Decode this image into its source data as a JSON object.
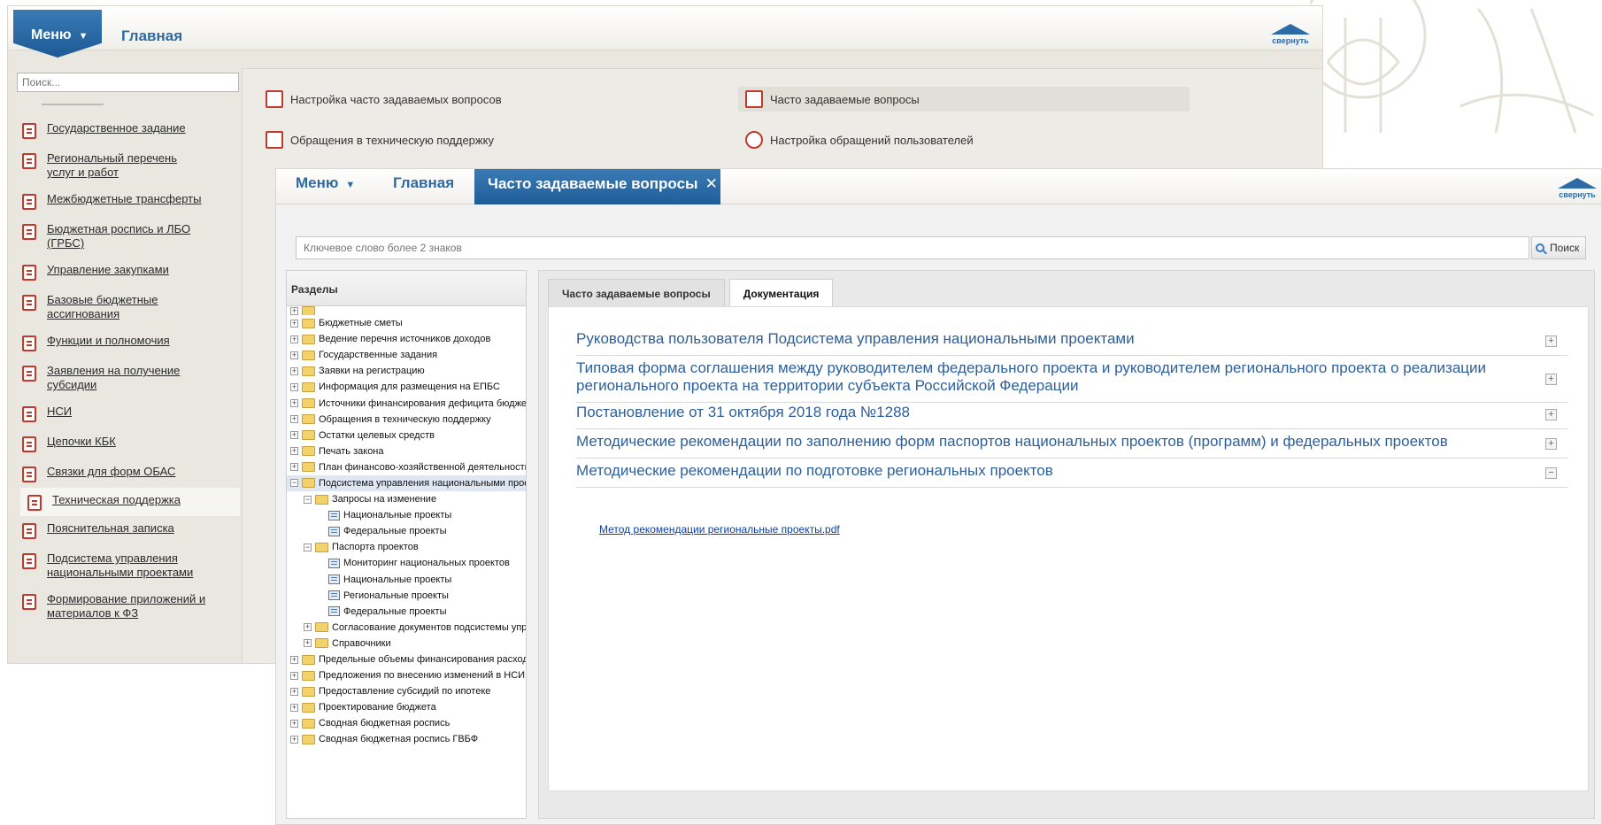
{
  "back_window": {
    "menu_label": "Меню",
    "home_label": "Главная",
    "collapse_label": "свернуть",
    "search_placeholder": "Поиск...",
    "sidebar_items": [
      {
        "label": "Государственное задание"
      },
      {
        "label": "Региональный перечень услуг и работ"
      },
      {
        "label": "Межбюджетные трансферты"
      },
      {
        "label": "Бюджетная роспись и ЛБО (ГРБС)"
      },
      {
        "label": "Управление закупками"
      },
      {
        "label": "Базовые бюджетные ассигнования"
      },
      {
        "label": "Функции и полномочия"
      },
      {
        "label": "Заявления на получение субсидии"
      },
      {
        "label": "НСИ"
      },
      {
        "label": "Цепочки КБК"
      },
      {
        "label": "Связки для форм ОБАС"
      },
      {
        "label": "Техническая поддержка",
        "active": true
      },
      {
        "label": "Пояснительная записка"
      },
      {
        "label": "Подсистема управления национальными проектами"
      },
      {
        "label": "Формирование приложений и материалов к ФЗ"
      }
    ],
    "links": [
      {
        "label": "Настройка часто задаваемых вопросов"
      },
      {
        "label": "Часто задаваемые вопросы"
      },
      {
        "label": "Обращения в техническую поддержку"
      },
      {
        "label": "Настройка обращений пользователей"
      }
    ]
  },
  "front_window": {
    "menu_label": "Меню",
    "home_label": "Главная",
    "active_tab": "Часто задаваемые вопросы",
    "collapse_label": "свернуть",
    "search": {
      "placeholder": "Ключевое слово более 2 знаков",
      "button_label": "Поиск"
    },
    "tree": {
      "header": "Разделы",
      "nodes": [
        {
          "label": "Бюджетные сметы",
          "level": 0,
          "type": "folder",
          "exp": "+"
        },
        {
          "label": "Ведение перечня источников доходов",
          "level": 0,
          "type": "folder",
          "exp": "+"
        },
        {
          "label": "Государственные задания",
          "level": 0,
          "type": "folder",
          "exp": "+"
        },
        {
          "label": "Заявки на регистрацию",
          "level": 0,
          "type": "folder",
          "exp": "+"
        },
        {
          "label": "Информация для размещения на ЕПБС",
          "level": 0,
          "type": "folder",
          "exp": "+"
        },
        {
          "label": "Источники финансирования дефицита бюджета",
          "level": 0,
          "type": "folder",
          "exp": "+"
        },
        {
          "label": "Обращения в техническую поддержку",
          "level": 0,
          "type": "folder",
          "exp": "+"
        },
        {
          "label": "Остатки целевых средств",
          "level": 0,
          "type": "folder",
          "exp": "+"
        },
        {
          "label": "Печать закона",
          "level": 0,
          "type": "folder",
          "exp": "+"
        },
        {
          "label": "План финансово-хозяйственной деятельности",
          "level": 0,
          "type": "folder",
          "exp": "+"
        },
        {
          "label": "Подсистема управления национальными проектами",
          "level": 0,
          "type": "folder",
          "exp": "−",
          "selected": true
        },
        {
          "label": "Запросы на изменение",
          "level": 1,
          "type": "folder",
          "exp": "−"
        },
        {
          "label": "Национальные проекты",
          "level": 2,
          "type": "doc"
        },
        {
          "label": "Федеральные проекты",
          "level": 2,
          "type": "doc"
        },
        {
          "label": "Паспорта проектов",
          "level": 1,
          "type": "folder",
          "exp": "−"
        },
        {
          "label": "Мониторинг национальных проектов",
          "level": 2,
          "type": "doc"
        },
        {
          "label": "Национальные проекты",
          "level": 2,
          "type": "doc"
        },
        {
          "label": "Региональные проекты",
          "level": 2,
          "type": "doc"
        },
        {
          "label": "Федеральные проекты",
          "level": 2,
          "type": "doc"
        },
        {
          "label": "Согласование документов подсистемы управлен",
          "level": 1,
          "type": "folder",
          "exp": "+"
        },
        {
          "label": "Справочники",
          "level": 1,
          "type": "folder",
          "exp": "+"
        },
        {
          "label": "Предельные объемы финансирования расходов",
          "level": 0,
          "type": "folder",
          "exp": "+"
        },
        {
          "label": "Предложения по внесению изменений в НСИ",
          "level": 0,
          "type": "folder",
          "exp": "+"
        },
        {
          "label": "Предоставление субсидий по ипотеке",
          "level": 0,
          "type": "folder",
          "exp": "+"
        },
        {
          "label": "Проектирование бюджета",
          "level": 0,
          "type": "folder",
          "exp": "+"
        },
        {
          "label": "Сводная бюджетная роспись",
          "level": 0,
          "type": "folder",
          "exp": "+"
        },
        {
          "label": "Сводная бюджетная роспись ГВБФ",
          "level": 0,
          "type": "folder",
          "exp": "+"
        }
      ]
    },
    "tabs": [
      {
        "label": "Часто задаваемые вопросы",
        "active": false
      },
      {
        "label": "Документация",
        "active": true
      }
    ],
    "documents": [
      {
        "title": "Руководства пользователя Подсистема управления национальными проектами",
        "toggle": "+"
      },
      {
        "title": "Типовая форма соглашения между руководителем федерального проекта и руководителем регионального проекта о реализации регионального проекта на территории субъекта Российской Федерации",
        "toggle": "+"
      },
      {
        "title": "Постановление от 31 октября 2018 года №1288",
        "toggle": "+"
      },
      {
        "title": "Методические рекомендации по заполнению форм паспортов национальных проектов (программ) и федеральных проектов",
        "toggle": "+"
      },
      {
        "title": "Методические рекомендации по подготовке региональных проектов",
        "toggle": "−"
      }
    ],
    "attachment_link": "Метод рекомендации региональные проекты.pdf"
  }
}
